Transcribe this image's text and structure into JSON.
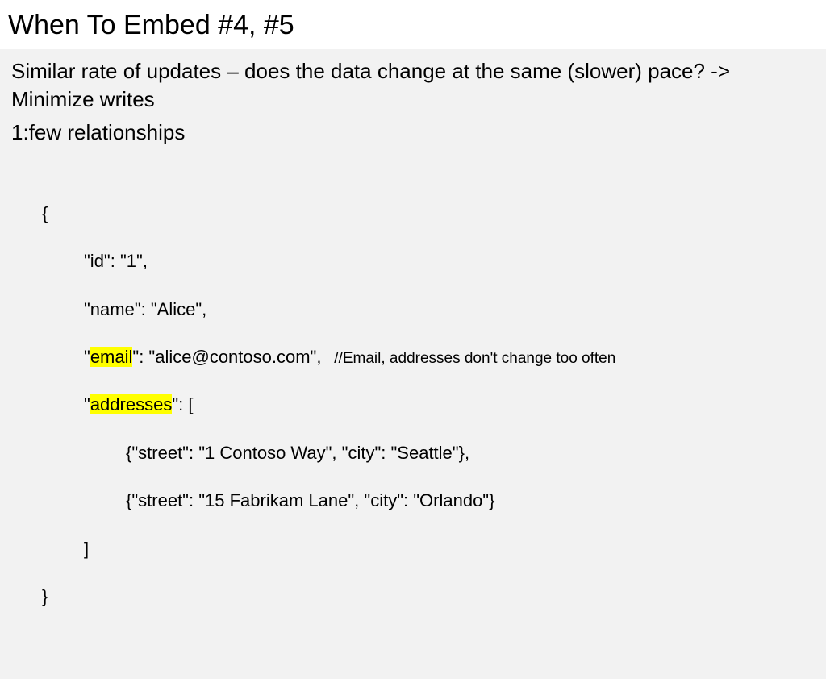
{
  "title": "When To Embed #4, #5",
  "bullets": {
    "p1": "Similar rate of updates – does the data change at the same (slower) pace? -> Minimize writes",
    "p2": "1:few relationships"
  },
  "code": {
    "open_brace": "{",
    "l_id_pre": "\"id\": \"1\",",
    "l_name": "\"name\": \"Alice\",",
    "l_email_q1": "\"",
    "l_email_key": "email",
    "l_email_rest": "\": \"alice@contoso.com\",",
    "l_email_comment": "   //Email, addresses don't change too often",
    "l_addr_q1": "\"",
    "l_addr_key": "addresses",
    "l_addr_rest": "\": [",
    "l_a1": "{\"street\": \"1 Contoso Way\", \"city\": \"Seattle\"},",
    "l_a2": "{\"street\": \"15 Fabrikam Lane\", \"city\": \"Orlando\"}",
    "l_close_arr": "]",
    "close_brace": "}"
  }
}
